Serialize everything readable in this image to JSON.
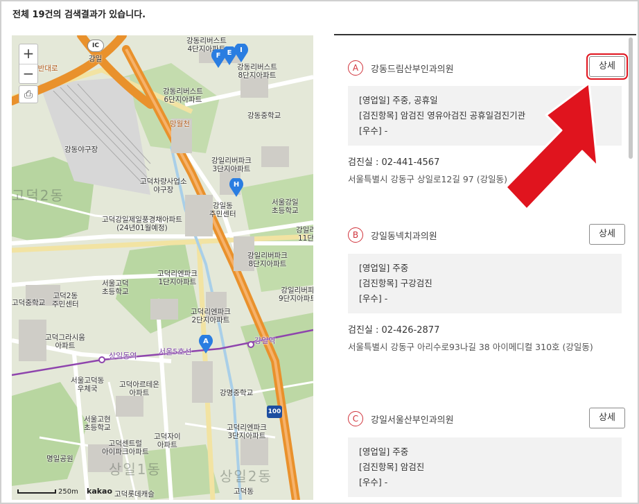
{
  "header": {
    "result_count_text": "전체 19건의 검색결과가 있습니다."
  },
  "map": {
    "zoom_in": "+",
    "zoom_out": "−",
    "print": "⎙",
    "ic_badge": "IC",
    "highway_badge": "100",
    "scale_label": "250m",
    "provider": "kakao",
    "labels": [
      {
        "text": "강일",
        "cls": ""
      },
      {
        "text": "강동리버스트\n4단지아파트",
        "cls": ""
      },
      {
        "text": "강동리버스트\n8단지아파트",
        "cls": ""
      },
      {
        "text": "강동리버스트\n6단지아파트",
        "cls": ""
      },
      {
        "text": "강동중학교",
        "cls": ""
      },
      {
        "text": "망월천",
        "cls": "road"
      },
      {
        "text": "강동야구장",
        "cls": ""
      },
      {
        "text": "강일리버파크\n3단지아파트",
        "cls": ""
      },
      {
        "text": "고덕차량사업소\n야구장",
        "cls": ""
      },
      {
        "text": "고덕2동",
        "cls": "big"
      },
      {
        "text": "강일동\n주민센터",
        "cls": ""
      },
      {
        "text": "서울강일\n초등학교",
        "cls": ""
      },
      {
        "text": "고덕강일제일풍경채아파트\n(24년01월예정)",
        "cls": ""
      },
      {
        "text": "강일리버파크\n8단지아파트",
        "cls": ""
      },
      {
        "text": "강일리\n11단",
        "cls": ""
      },
      {
        "text": "고덕리엔파크\n1단지아파트",
        "cls": ""
      },
      {
        "text": "서울고덕\n초등학교",
        "cls": ""
      },
      {
        "text": "고덕2동\n주민센터",
        "cls": ""
      },
      {
        "text": "고덕중학교",
        "cls": ""
      },
      {
        "text": "고덕리엔파크\n2단지아파트",
        "cls": ""
      },
      {
        "text": "강일리버파\n9단지아파트",
        "cls": ""
      },
      {
        "text": "고덕그라시움\n아파트",
        "cls": ""
      },
      {
        "text": "상일동역",
        "cls": "subway"
      },
      {
        "text": "서울5호선",
        "cls": "subway"
      },
      {
        "text": "강일역",
        "cls": "subway"
      },
      {
        "text": "서울고덕동\n우체국",
        "cls": ""
      },
      {
        "text": "고덕아르테온\n아파트",
        "cls": ""
      },
      {
        "text": "강명중학교",
        "cls": ""
      },
      {
        "text": "서울고현\n초등학교",
        "cls": ""
      },
      {
        "text": "고덕리엔파크\n3단지아파트",
        "cls": ""
      },
      {
        "text": "고덕자이\n아파트",
        "cls": ""
      },
      {
        "text": "고덕센트럴\n아이파크아파트",
        "cls": ""
      },
      {
        "text": "명일공원",
        "cls": ""
      },
      {
        "text": "상일1동",
        "cls": "big"
      },
      {
        "text": "상일2동",
        "cls": "big"
      },
      {
        "text": "고덕롯데캐슬",
        "cls": ""
      },
      {
        "text": "고덕동",
        "cls": ""
      },
      {
        "text": "일반대로",
        "cls": "road"
      }
    ],
    "markers": [
      "F",
      "E",
      "I",
      "H",
      "A"
    ]
  },
  "results": [
    {
      "letter": "A",
      "name": "강동드림산부인과의원",
      "detail_label": "상세",
      "work_days": "[영업일] 주중, 공휴일",
      "exam_items": "[검진항목] 암검진 영유아검진 공휴일검진기관",
      "excellent": "[우수] -",
      "phone": "검진실 :  02-441-4567",
      "address": "서울특별시 강동구 상일로12길 97 (강일동)"
    },
    {
      "letter": "B",
      "name": "강일동넥치과의원",
      "detail_label": "상세",
      "work_days": "[영업일] 주중",
      "exam_items": "[검진항목] 구강검진",
      "excellent": "[우수] -",
      "phone": "검진실 :  02-426-2877",
      "address": "서울특별시 강동구 아리수로93나길 38 아이메디컬 310호 (강일동)"
    },
    {
      "letter": "C",
      "name": "강일서울산부인과의원",
      "detail_label": "상세",
      "work_days": "[영업일] 주중",
      "exam_items": "[검진항목] 암검진",
      "excellent": "[우수] -"
    }
  ],
  "colors": {
    "accent_red": "#d0323a",
    "highlight_red": "#e0141e",
    "marker_blue": "#2a7de1",
    "highway_orange": "#e9912c"
  }
}
